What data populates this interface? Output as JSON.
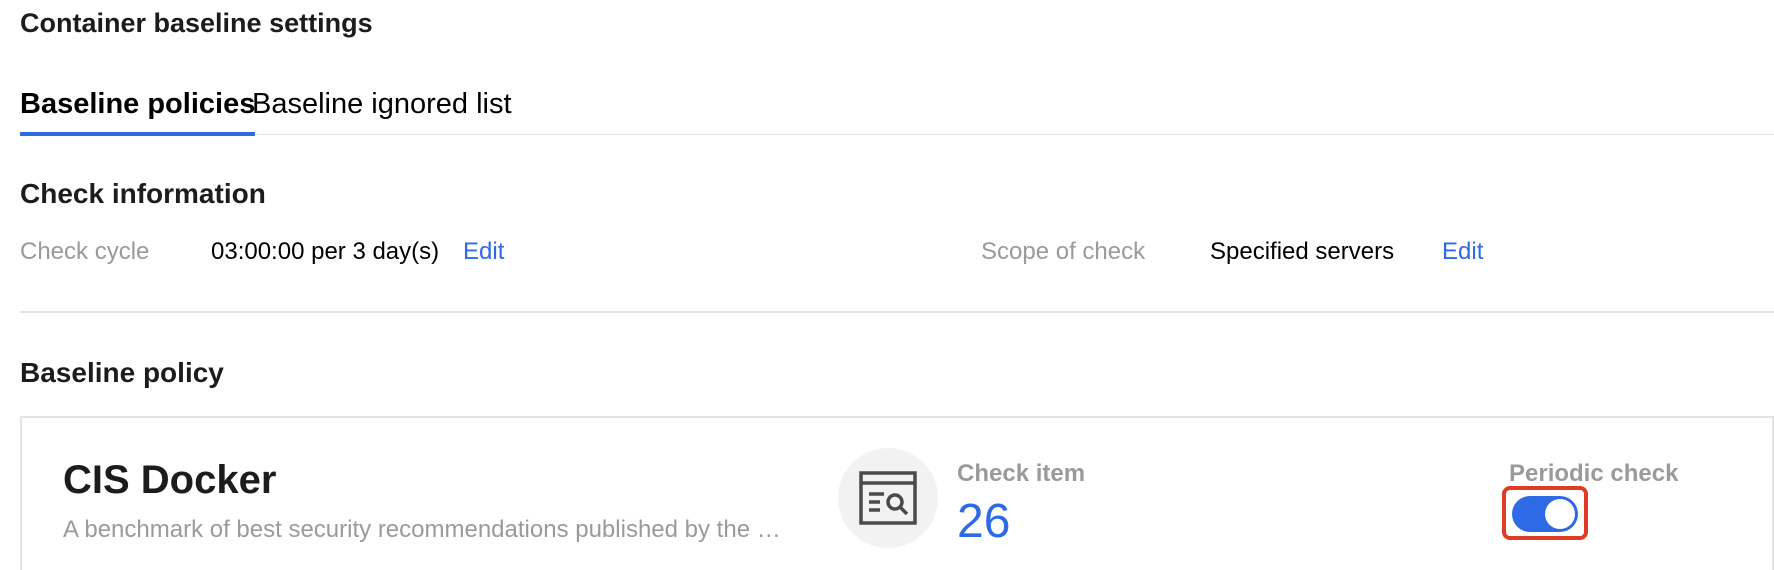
{
  "page": {
    "title": "Container baseline settings"
  },
  "tabs": [
    {
      "label": "Baseline policies",
      "active": true
    },
    {
      "label": "Baseline ignored list",
      "active": false
    }
  ],
  "check_information": {
    "heading": "Check information",
    "check_cycle_label": "Check cycle",
    "check_cycle_value": "03:00:00 per 3 day(s)",
    "check_cycle_edit": "Edit",
    "scope_label": "Scope of check",
    "scope_value": "Specified servers",
    "scope_edit": "Edit"
  },
  "baseline_policy": {
    "heading": "Baseline policy",
    "card": {
      "name": "CIS Docker",
      "description": "A benchmark of best security recommendations published by the …",
      "icon": "document-search-icon",
      "check_item_label": "Check item",
      "check_item_value": "26",
      "periodic_check_label": "Periodic check",
      "periodic_check_enabled": true
    }
  },
  "colors": {
    "accent": "#2f6ae6",
    "highlight": "#e03b24",
    "muted_text": "#9a9a9a",
    "divider": "#e2e4e8"
  }
}
